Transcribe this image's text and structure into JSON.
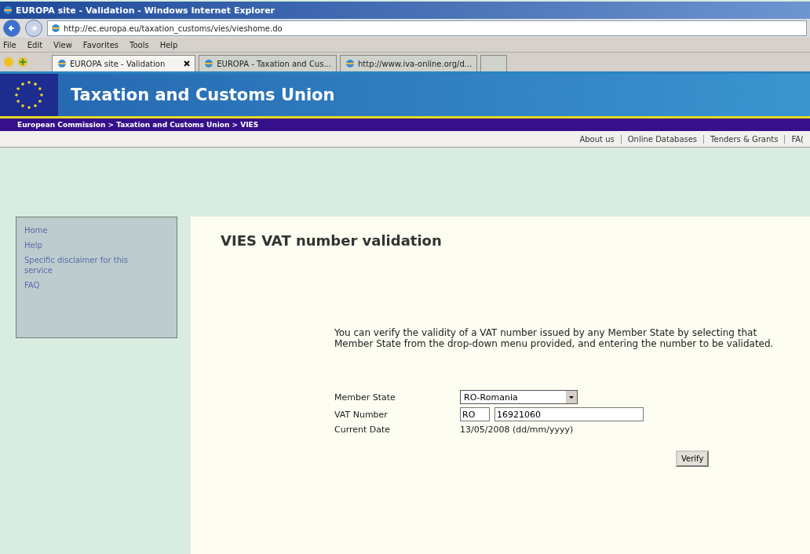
{
  "window": {
    "title": "EUROPA site - Validation - Windows Internet Explorer"
  },
  "address_bar": {
    "url": "http://ec.europa.eu/taxation_customs/vies/vieshome.do"
  },
  "menu": [
    "File",
    "Edit",
    "View",
    "Favorites",
    "Tools",
    "Help"
  ],
  "tabs": [
    {
      "label": "EUROPA site - Validation",
      "selected": true
    },
    {
      "label": "EUROPA - Taxation and Cus...",
      "selected": false
    },
    {
      "label": "http://www.iva-online.org/d...",
      "selected": false
    }
  ],
  "site_header": {
    "title": "Taxation and Customs Union"
  },
  "breadcrumb": "European Commission > Taxation and Customs Union > VIES",
  "top_links": [
    "About us",
    "Online Databases",
    "Tenders & Grants",
    "FA("
  ],
  "sidebar": {
    "items": [
      "Home",
      "Help",
      "Specific disclaimer for this service",
      "FAQ"
    ]
  },
  "main": {
    "heading": "VIES VAT number validation",
    "intro": "You can verify the validity of a VAT number issued by any Member State by selecting that Member State from the drop-down menu provided, and entering the number to be validated.",
    "form": {
      "member_state": {
        "label": "Member State",
        "value": "RO-Romania"
      },
      "vat_number": {
        "label": "VAT Number",
        "prefix": "RO",
        "value": "16921060"
      },
      "current_date": {
        "label": "Current Date",
        "value": "13/05/2008 (dd/mm/yyyy)"
      },
      "button": "Verify"
    }
  }
}
